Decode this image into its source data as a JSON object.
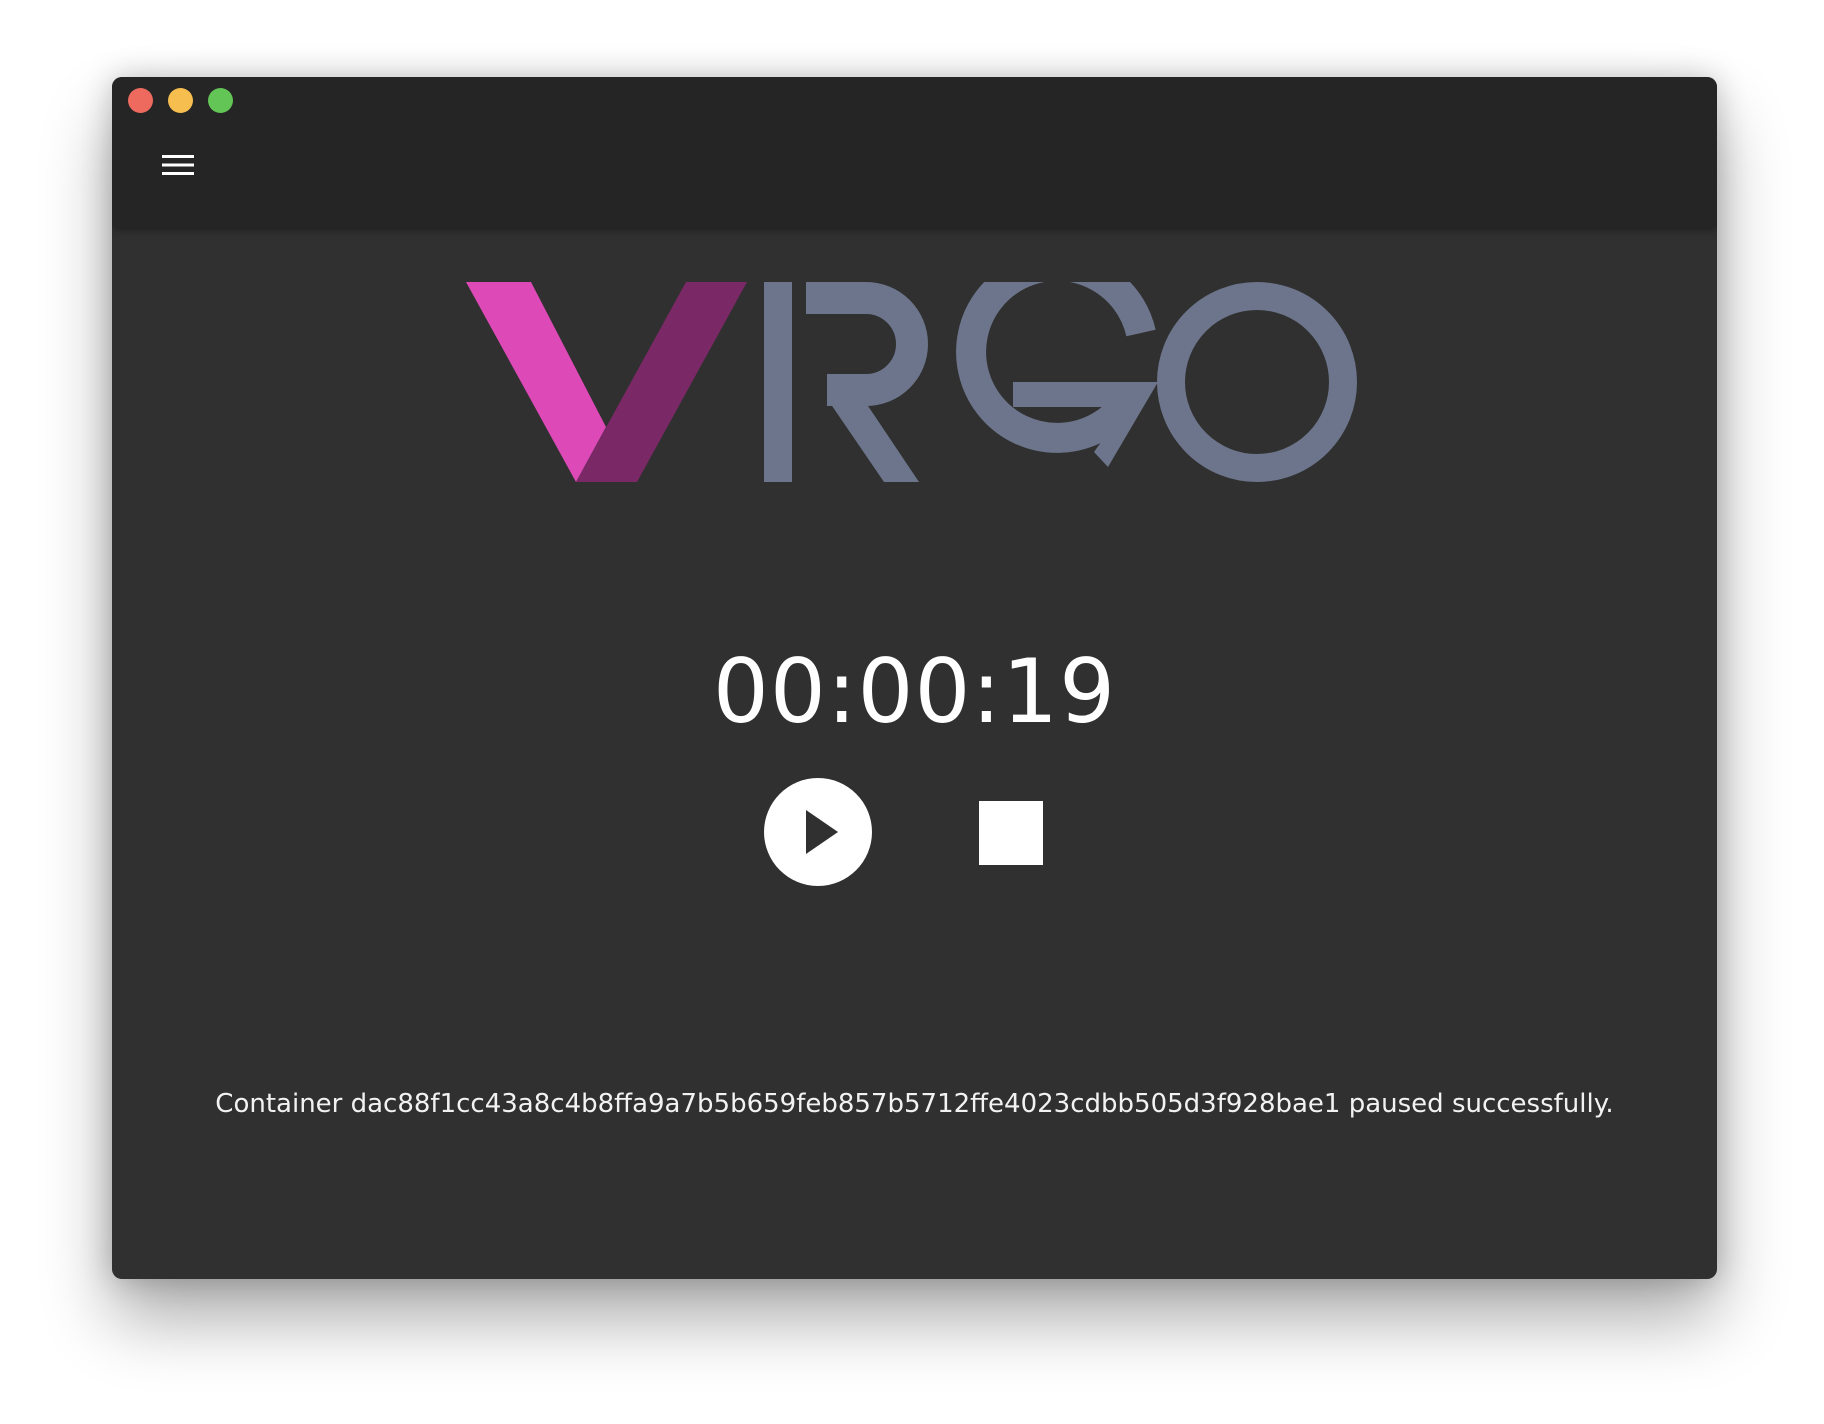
{
  "window": {
    "traffic_lights": {
      "close_color": "#ee6a5f",
      "minimize_color": "#f5be4f",
      "zoom_color": "#62c555"
    }
  },
  "toolbar": {
    "menu_icon": "hamburger-menu-icon"
  },
  "logo": {
    "text": "VIRGO",
    "v_left_color": "#dd49b7",
    "v_right_color": "#7a2966",
    "letters_color": "#6c758b"
  },
  "timer": {
    "value": "00:00:19"
  },
  "controls": {
    "play_icon": "play-icon",
    "stop_icon": "stop-icon"
  },
  "status": {
    "message": "Container dac88f1cc43a8c4b8ffa9a7b5b659feb857b5712ffe4023cdbb505d3f928bae1 paused successfully."
  }
}
